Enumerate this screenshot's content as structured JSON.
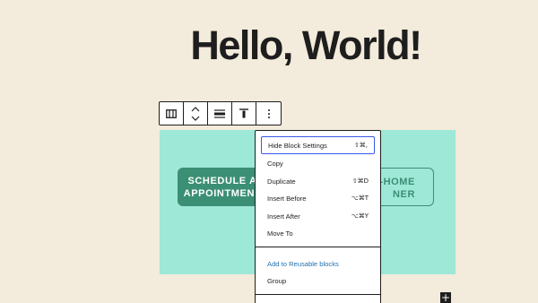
{
  "heading": "Hello, World!",
  "toolbar": {
    "icons": [
      "columns-icon",
      "move-up-down-icon",
      "align-icon",
      "vertical-align-top-icon",
      "more-options-icon"
    ]
  },
  "group": {
    "background": "#9ee8d7",
    "button_primary": {
      "line1": "SCHEDULE A",
      "line2": "APPOINTMENT"
    },
    "button_secondary": {
      "line1": "T-HOME",
      "line2": "NER"
    },
    "accent": "#3b8f74"
  },
  "menu": {
    "section1": [
      {
        "label": "Hide Block Settings",
        "shortcut": "⇧⌘,",
        "focused": true
      },
      {
        "label": "Copy",
        "shortcut": ""
      },
      {
        "label": "Duplicate",
        "shortcut": "⇧⌘D"
      },
      {
        "label": "Insert Before",
        "shortcut": "⌥⌘T"
      },
      {
        "label": "Insert After",
        "shortcut": "⌥⌘Y"
      },
      {
        "label": "Move To",
        "shortcut": ""
      }
    ],
    "section2": [
      {
        "label": "Add to Reusable blocks"
      },
      {
        "label": "Group"
      }
    ]
  },
  "inserter": {
    "label": "+"
  }
}
